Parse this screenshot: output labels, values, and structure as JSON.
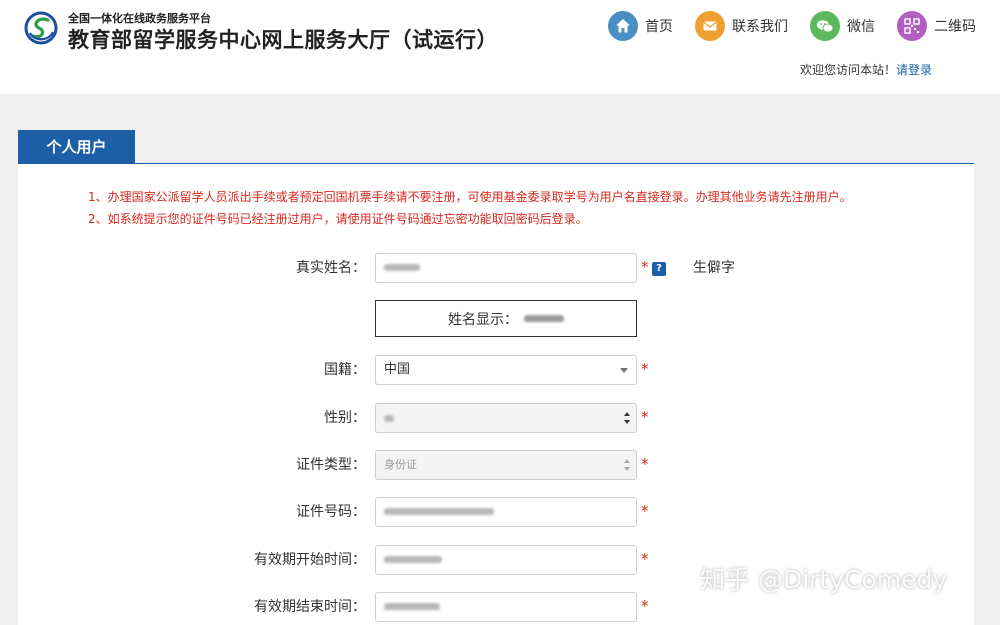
{
  "header": {
    "subtitle": "全国一体化在线政务服务平台",
    "title": "教育部留学服务中心网上服务大厅（试运行）",
    "logo_icon": "cscse-logo-icon"
  },
  "nav": {
    "items": [
      {
        "label": "首页",
        "icon": "home-icon",
        "color": "#4a8fc4"
      },
      {
        "label": "联系我们",
        "icon": "mail-icon",
        "color": "#f0a030"
      },
      {
        "label": "微信",
        "icon": "wechat-icon",
        "color": "#5cb85c"
      },
      {
        "label": "二维码",
        "icon": "qrcode-icon",
        "color": "#b05ec0"
      }
    ]
  },
  "welcome": {
    "text": "欢迎您访问本站！",
    "login_link": "请登录"
  },
  "tab": {
    "label": "个人用户"
  },
  "notices": [
    "1、办理国家公派留学人员派出手续或者预定回国机票手续请不要注册，可使用基金委录取学号为用户名直接登录。办理其他业务请先注册用户。",
    "2、如系统提示您的证件号码已经注册过用户，请使用证件号码通过忘密功能取回密码后登录。"
  ],
  "form": {
    "name": {
      "label": "真实姓名：",
      "required": "*",
      "help": "?",
      "rare_link": "生僻字"
    },
    "display": {
      "label": "姓名显示："
    },
    "nationality": {
      "label": "国籍：",
      "value": "中国",
      "required": "*"
    },
    "gender": {
      "label": "性别：",
      "required": "*"
    },
    "id_type": {
      "label": "证件类型：",
      "value": "身份证",
      "required": "*"
    },
    "id_number": {
      "label": "证件号码：",
      "required": "*"
    },
    "valid_start": {
      "label": "有效期开始时间：",
      "required": "*"
    },
    "valid_end": {
      "label": "有效期结束时间：",
      "required": "*"
    }
  },
  "watermark": "知乎 @DirtyComedy",
  "colors": {
    "accent": "#1d5fa7",
    "notice": "#d9281f",
    "link": "#1a5fa8"
  }
}
